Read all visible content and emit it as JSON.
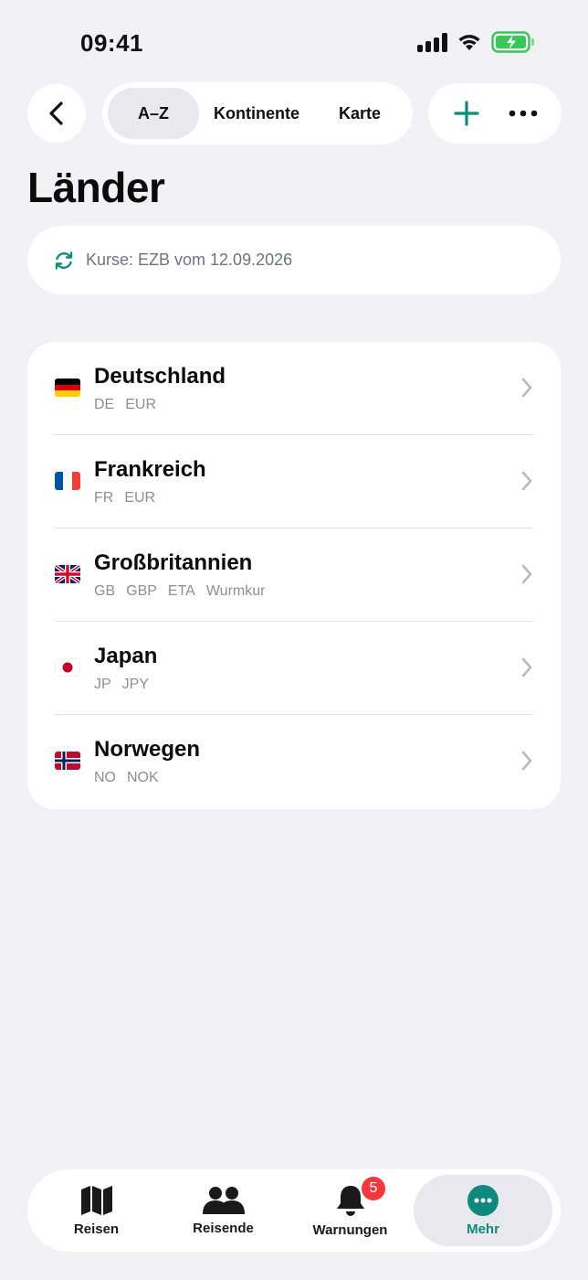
{
  "status_bar": {
    "time": "09:41"
  },
  "colors": {
    "accent": "#0E8A7C",
    "badge": "#F2383B",
    "battery": "#3BC65B"
  },
  "toolbar": {
    "back_icon": "chevron-left-icon",
    "segments": [
      {
        "label": "A–Z",
        "active": true
      },
      {
        "label": "Kontinente",
        "active": false
      },
      {
        "label": "Karte",
        "active": false
      }
    ],
    "add_icon": "plus-icon",
    "more_icon": "ellipsis-icon"
  },
  "page": {
    "title": "Länder"
  },
  "rates": {
    "icon": "refresh-icon",
    "text": "Kurse: EZB vom 12.09.2026"
  },
  "countries": [
    {
      "name": "Deutschland",
      "flag": "flag-de",
      "tags": [
        "DE",
        "EUR"
      ]
    },
    {
      "name": "Frankreich",
      "flag": "flag-fr",
      "tags": [
        "FR",
        "EUR"
      ]
    },
    {
      "name": "Großbritannien",
      "flag": "flag-gb",
      "tags": [
        "GB",
        "GBP",
        "ETA",
        "Wurmkur"
      ]
    },
    {
      "name": "Japan",
      "flag": "flag-jp",
      "tags": [
        "JP",
        "JPY"
      ]
    },
    {
      "name": "Norwegen",
      "flag": "flag-no",
      "tags": [
        "NO",
        "NOK"
      ]
    }
  ],
  "tabbar": {
    "tabs": [
      {
        "label": "Reisen",
        "icon": "map-icon",
        "active": false
      },
      {
        "label": "Reisende",
        "icon": "people-icon",
        "active": false
      },
      {
        "label": "Warnungen",
        "icon": "bell-icon",
        "active": false,
        "badge": "5"
      },
      {
        "label": "Mehr",
        "icon": "more-circle-icon",
        "active": true
      }
    ]
  }
}
